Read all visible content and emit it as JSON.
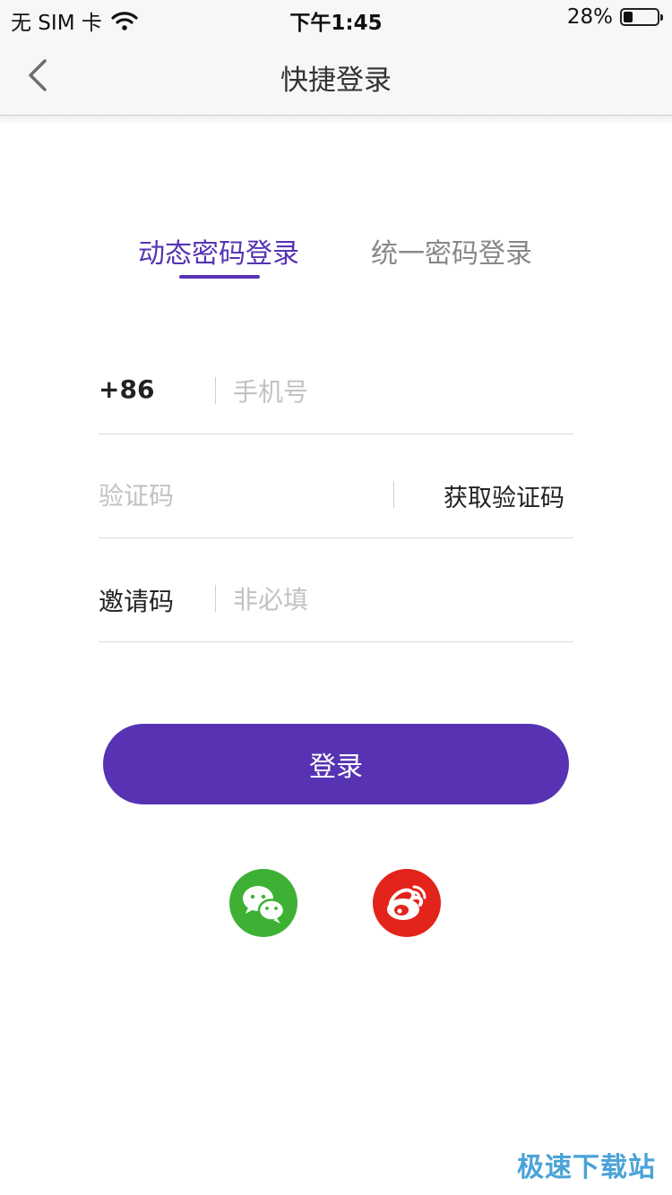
{
  "status_bar": {
    "carrier": "无 SIM 卡",
    "time": "下午1:45",
    "battery": "28%",
    "battery_level": 0.28,
    "wifi_icon": "wifi-icon"
  },
  "nav": {
    "title": "快捷登录",
    "back_icon": "chevron-left-icon"
  },
  "tabs": [
    {
      "label": "动态密码登录",
      "active": true
    },
    {
      "label": "统一密码登录",
      "active": false
    }
  ],
  "form": {
    "country_code": "+86",
    "phone_placeholder": "手机号",
    "code_placeholder": "验证码",
    "get_code_label": "获取验证码",
    "invite_label": "邀请码",
    "invite_placeholder": "非必填"
  },
  "login_button": "登录",
  "social": [
    {
      "name": "wechat-icon",
      "color": "#3eb135"
    },
    {
      "name": "weibo-icon",
      "color": "#e3241b"
    }
  ],
  "colors": {
    "accent": "#5733b3"
  },
  "watermark": "极速下载站"
}
